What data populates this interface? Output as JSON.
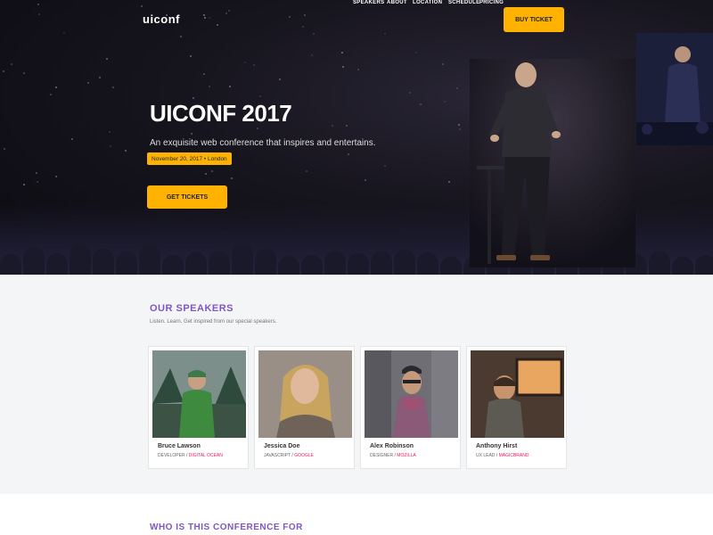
{
  "brand": {
    "logo_text": "uiconf"
  },
  "nav": {
    "items": [
      "SPEAKERS",
      "ABOUT",
      "LOCATION",
      "SCHEDULE",
      "PRICING"
    ],
    "cta_label": "BUY TICKET"
  },
  "hero": {
    "title": "UICONF",
    "year": "2017",
    "tagline": "An exquisite web conference that inspires and entertains.",
    "date_location": "November 20, 2017 • London",
    "button_label": "GET TICKETS"
  },
  "speakers": {
    "title": "OUR SPEAKERS",
    "subtitle": "Listen. Learn. Get inspired from our special speakers.",
    "cards": [
      {
        "name": "Bruce Lawson",
        "role": "DEVELOPER",
        "company": "DIGITAL OCEAN"
      },
      {
        "name": "Jessica Doe",
        "role": "JAVASCRIPT",
        "company": "GOOGLE"
      },
      {
        "name": "Alex Robinson",
        "role": "DESIGNER",
        "company": "MOZILLA"
      },
      {
        "name": "Anthony Hirst",
        "role": "UX LEAD",
        "company": "MAGICBRAND"
      }
    ]
  },
  "who": {
    "title": "WHO IS THIS CONFERENCE FOR"
  },
  "colors": {
    "accent": "#ffb300",
    "purple": "#7e57c2",
    "pink": "#e91e63"
  }
}
